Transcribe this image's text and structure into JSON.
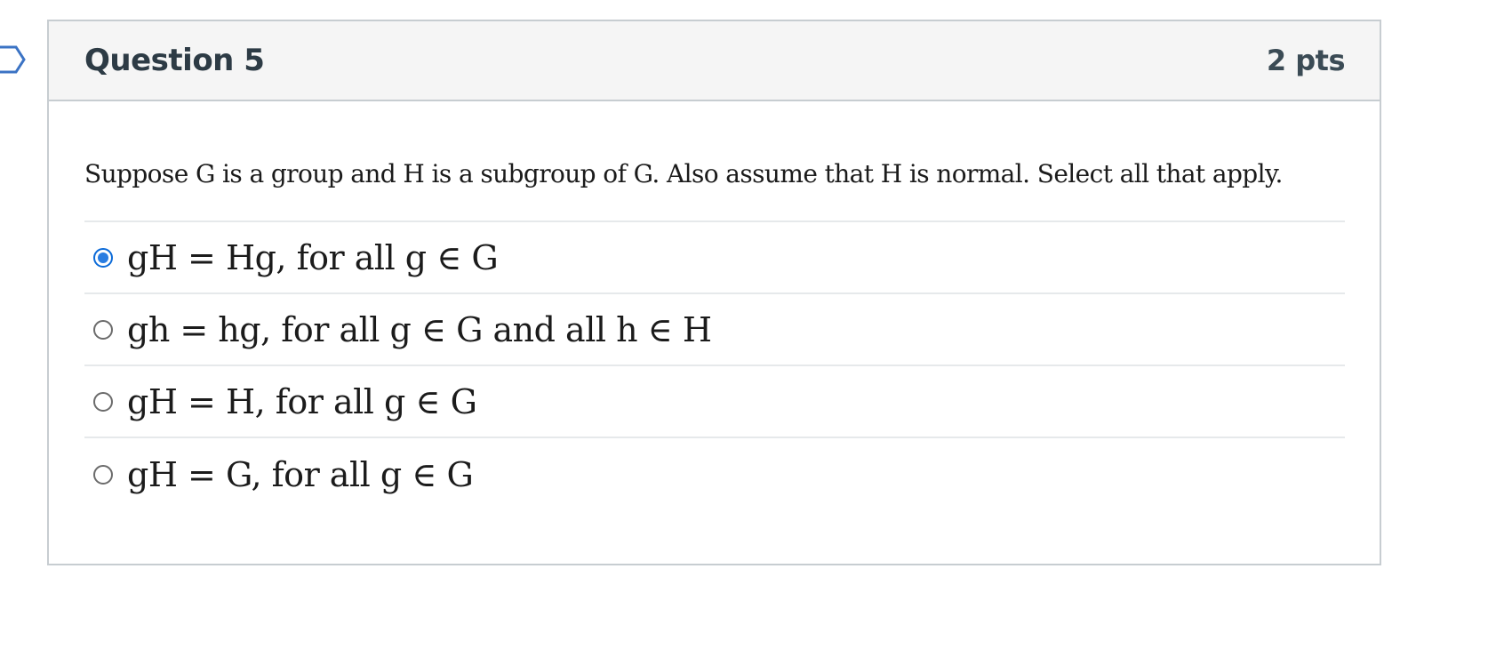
{
  "question": {
    "title": "Question 5",
    "points": "2 pts",
    "prompt": "Suppose G is a group and H is a subgroup of G. Also assume that H is normal. Select all that apply."
  },
  "answers": [
    {
      "text": "gH = Hg, for all g ∈ G",
      "selected": true
    },
    {
      "text": "gh = hg, for all g ∈ G and all h ∈ H",
      "selected": false
    },
    {
      "text": "gH = H, for all g ∈ G",
      "selected": false
    },
    {
      "text": "gH = G, for all g ∈ G",
      "selected": false
    }
  ],
  "icons": {
    "bookmark": "bookmark-flag-icon",
    "radio": "radio-button-icon"
  },
  "colors": {
    "radio_selected": "#2a7de1",
    "header_bg": "#f5f5f5",
    "border": "#c7cdd1"
  }
}
